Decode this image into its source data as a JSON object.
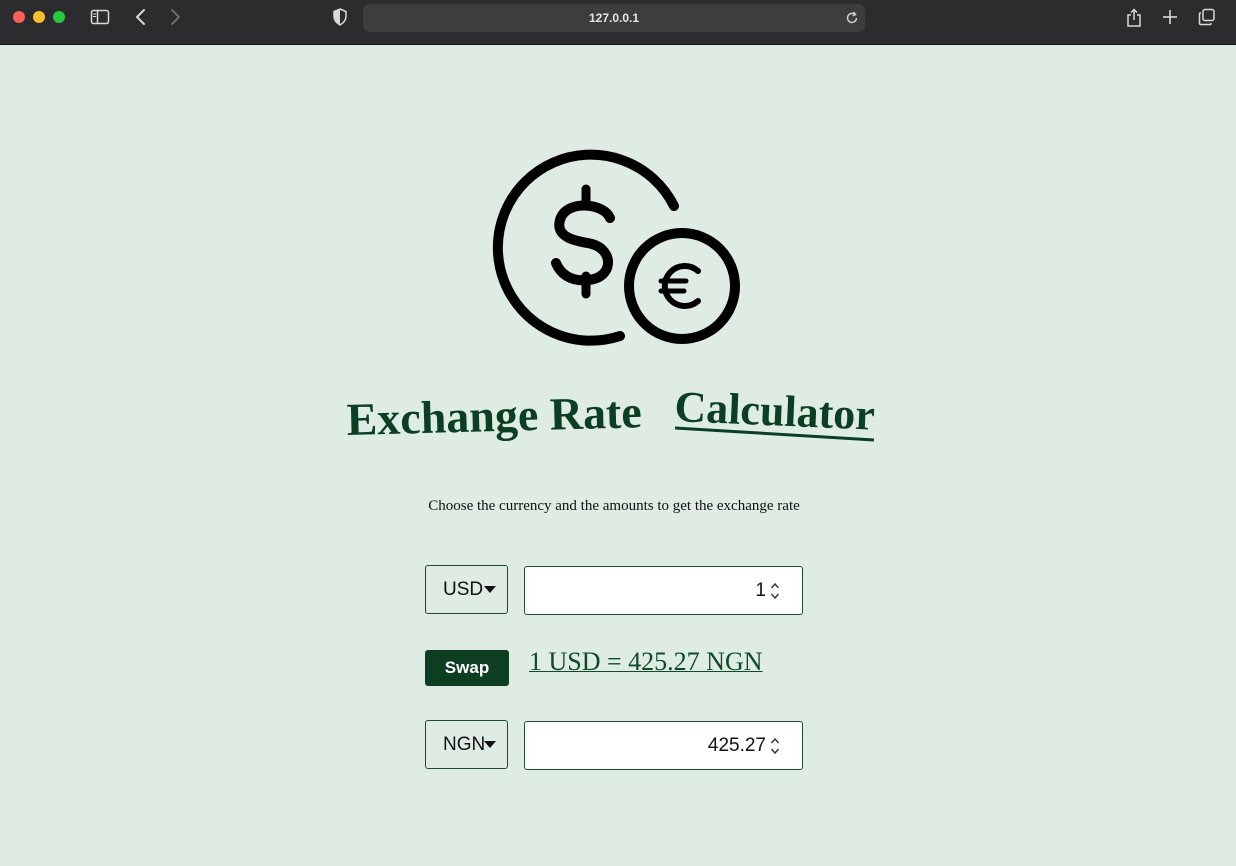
{
  "browser": {
    "url": "127.0.0.1"
  },
  "header": {
    "title_part1": "Exchange Rate",
    "title_part2": "Calculator",
    "subtitle": "Choose the currency and the amounts to get the exchange rate"
  },
  "converter": {
    "from_currency": "USD",
    "from_amount": "1",
    "swap_label": "Swap",
    "rate_text": "1 USD = 425.27 NGN",
    "to_currency": "NGN",
    "to_amount": "425.27"
  },
  "colors": {
    "background": "#dfece3",
    "accent": "#0d3e22",
    "title": "#0b3f24"
  }
}
